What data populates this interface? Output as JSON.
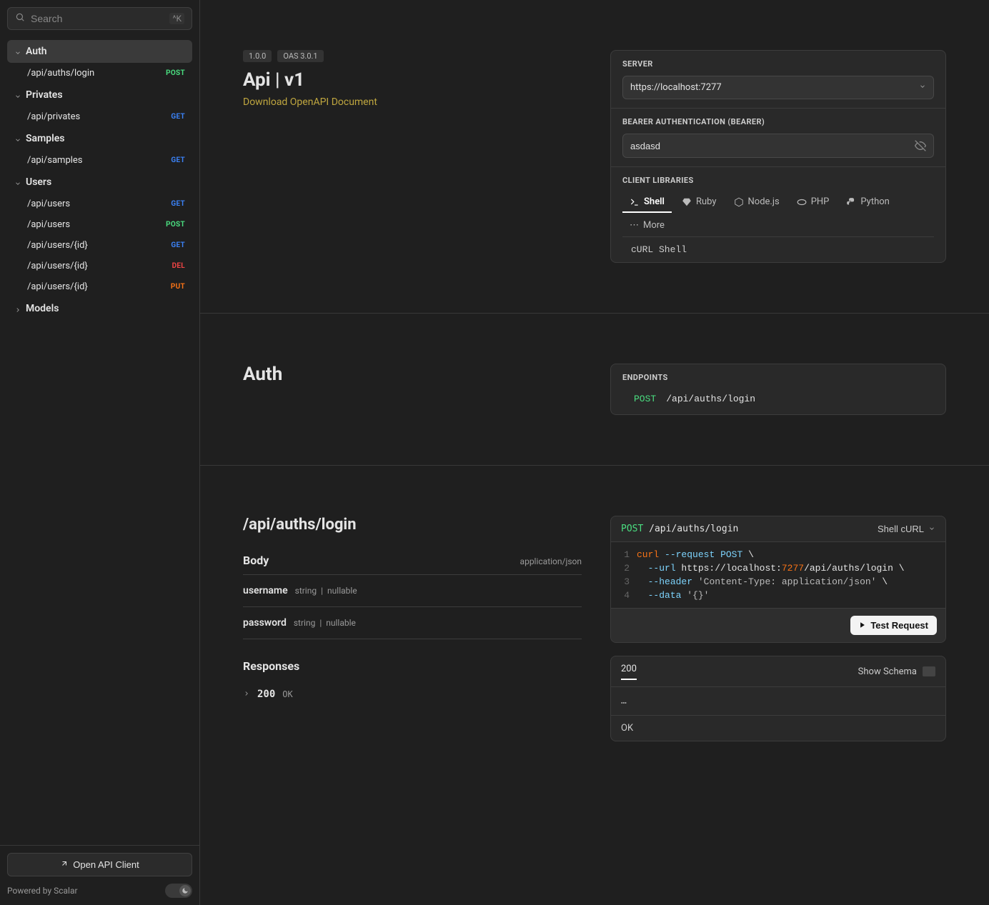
{
  "search": {
    "placeholder": "Search",
    "shortcut": "^K"
  },
  "sidebar": {
    "groups": [
      {
        "label": "Auth",
        "expanded": true,
        "active": true,
        "items": [
          {
            "path": "/api/auths/login",
            "method": "POST"
          }
        ]
      },
      {
        "label": "Privates",
        "expanded": true,
        "items": [
          {
            "path": "/api/privates",
            "method": "GET"
          }
        ]
      },
      {
        "label": "Samples",
        "expanded": true,
        "items": [
          {
            "path": "/api/samples",
            "method": "GET"
          }
        ]
      },
      {
        "label": "Users",
        "expanded": true,
        "items": [
          {
            "path": "/api/users",
            "method": "GET"
          },
          {
            "path": "/api/users",
            "method": "POST"
          },
          {
            "path": "/api/users/{id}",
            "method": "GET"
          },
          {
            "path": "/api/users/{id}",
            "method": "DEL"
          },
          {
            "path": "/api/users/{id}",
            "method": "PUT"
          }
        ]
      },
      {
        "label": "Models",
        "expanded": false,
        "items": []
      }
    ],
    "open_client": "Open API Client",
    "powered": "Powered by Scalar"
  },
  "header": {
    "version": "1.0.0",
    "oas": "OAS 3.0.1",
    "title": "Api | v1",
    "download": "Download OpenAPI Document"
  },
  "server": {
    "label": "SERVER",
    "value": "https://localhost:7277"
  },
  "auth": {
    "label": "BEARER AUTHENTICATION (BEARER)",
    "value": "asdasd"
  },
  "libs": {
    "label": "CLIENT LIBRARIES",
    "tabs": [
      "Shell",
      "Ruby",
      "Node.js",
      "PHP",
      "Python"
    ],
    "more": "More",
    "output": "cURL Shell"
  },
  "auth_section": {
    "title": "Auth",
    "endpoints_label": "ENDPOINTS",
    "endpoint": {
      "method": "POST",
      "path": "/api/auths/login"
    }
  },
  "operation": {
    "title": "/api/auths/login",
    "body_label": "Body",
    "content_type": "application/json",
    "params": [
      {
        "name": "username",
        "type": "string",
        "nullable": "nullable"
      },
      {
        "name": "password",
        "type": "string",
        "nullable": "nullable"
      }
    ],
    "responses_label": "Responses",
    "response": {
      "code": "200",
      "label": "OK"
    }
  },
  "request_panel": {
    "method": "POST",
    "path": "/api/auths/login",
    "lang": "Shell cURL",
    "lines": [
      {
        "n": "1",
        "parts": [
          {
            "t": "curl",
            "c": "c-cmd"
          },
          {
            "t": " "
          },
          {
            "t": "--request",
            "c": "c-flag"
          },
          {
            "t": " "
          },
          {
            "t": "POST",
            "c": "c-meth"
          },
          {
            "t": " \\"
          }
        ]
      },
      {
        "n": "2",
        "parts": [
          {
            "t": "  "
          },
          {
            "t": "--url",
            "c": "c-flag"
          },
          {
            "t": " https://localhost:"
          },
          {
            "t": "7277",
            "c": "c-num"
          },
          {
            "t": "/api/auths/login \\"
          }
        ]
      },
      {
        "n": "3",
        "parts": [
          {
            "t": "  "
          },
          {
            "t": "--header",
            "c": "c-flag"
          },
          {
            "t": " "
          },
          {
            "t": "'Content-Type: application/json'",
            "c": "c-str"
          },
          {
            "t": " \\"
          }
        ]
      },
      {
        "n": "4",
        "parts": [
          {
            "t": "  "
          },
          {
            "t": "--data",
            "c": "c-flag"
          },
          {
            "t": " "
          },
          {
            "t": "'{}'",
            "c": "c-str"
          }
        ]
      }
    ],
    "test_label": "Test Request"
  },
  "response_panel": {
    "code": "200",
    "show_schema": "Show Schema",
    "body": "…",
    "status": "OK"
  }
}
